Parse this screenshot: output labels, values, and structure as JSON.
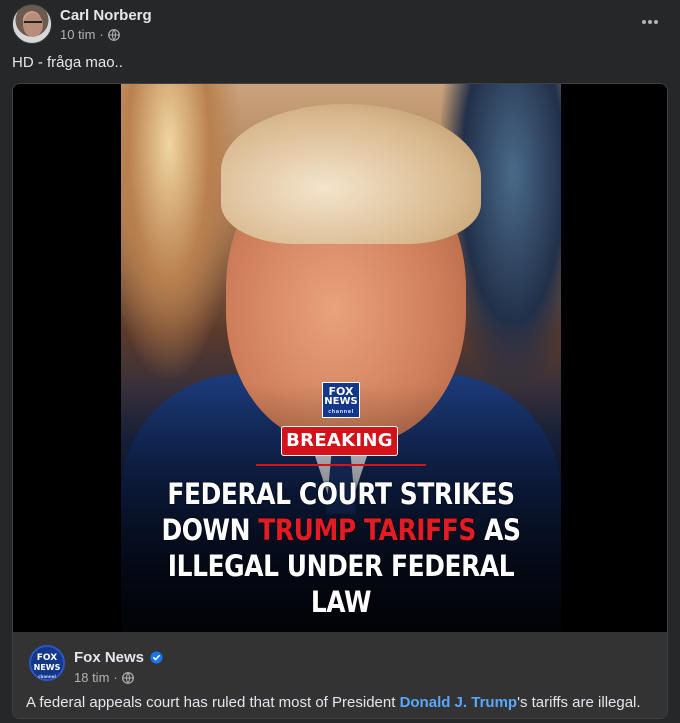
{
  "post": {
    "author": "Carl Norberg",
    "time": "10 tim",
    "separator": "·",
    "privacy_icon": "globe-icon",
    "caption": "HD - fråga mao.."
  },
  "shared": {
    "image": {
      "logo_line1": "FOX",
      "logo_line2": "NEWS",
      "logo_line3": "channel",
      "badge": "BREAKING",
      "headline_line1": "FEDERAL COURT STRIKES",
      "headline_line2_pre": "DOWN ",
      "headline_line2_red": "TRUMP TARIFFS",
      "headline_line2_post": " AS",
      "headline_line3": "ILLEGAL UNDER FEDERAL LAW"
    },
    "source": {
      "name": "Fox News",
      "verified_icon": "verified-badge-icon",
      "time": "18 tim",
      "separator": "·",
      "privacy_icon": "globe-icon",
      "text_pre": "A federal appeals court has ruled that most of President ",
      "mention": "Donald J. Trump",
      "text_post": "'s tariffs are illegal."
    }
  },
  "colors": {
    "background": "#252728",
    "accent_red": "#e31b23",
    "link_blue": "#5aa7ff",
    "verified_blue": "#1877f2"
  }
}
